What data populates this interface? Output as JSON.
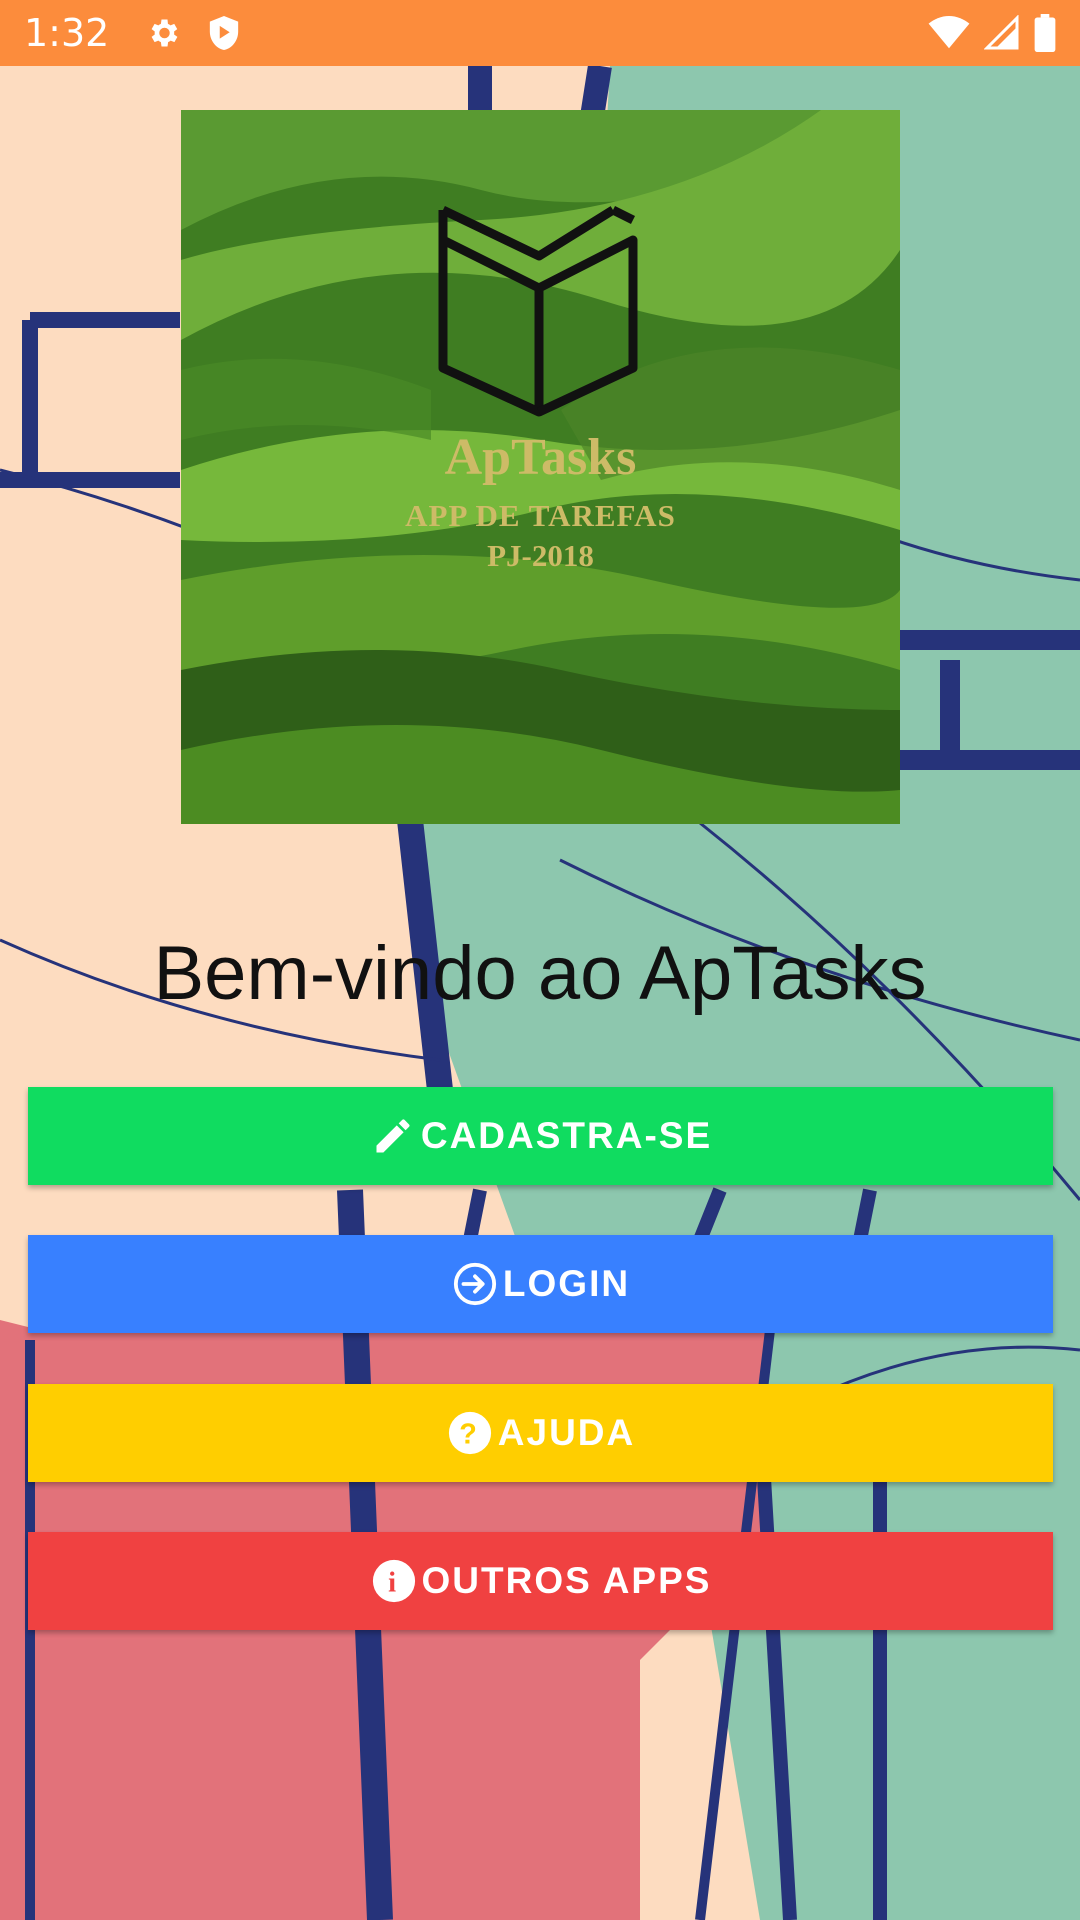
{
  "status_bar": {
    "time": "1:32",
    "color": "#fc8c3c",
    "icons": [
      "settings-icon",
      "shield-icon",
      "wifi-icon",
      "signal-icon",
      "battery-icon"
    ]
  },
  "logo": {
    "name": "ApTasks",
    "subtitle": "APP DE TAREFAS",
    "subtitle2": "PJ-2018",
    "icon": "open-book-icon"
  },
  "welcome_text": "Bem-vindo ao ApTasks",
  "buttons": {
    "register": {
      "label": "CADASTRA-SE",
      "icon": "pencil-icon",
      "color": "#10dc60"
    },
    "login": {
      "label": "LOGIN",
      "icon": "log-in-icon",
      "color": "#3880ff"
    },
    "help": {
      "label": "AJUDA",
      "icon": "help-circle-icon",
      "color": "#ffce00"
    },
    "apps": {
      "label": "OUTROS APPS",
      "icon": "information-circle-icon",
      "color": "#f04141"
    }
  }
}
